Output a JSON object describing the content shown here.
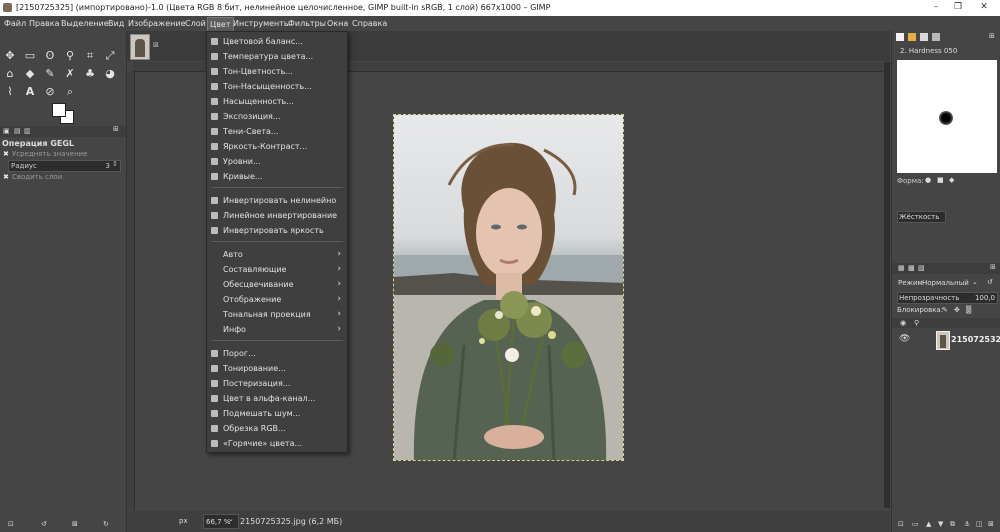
{
  "window": {
    "title": "[2150725325] (импортировано)-1.0 (Цвета RGB 8 бит, нелинейное целочисленное, GIMP built-in sRGB, 1 слой) 667x1000 – GIMP",
    "minimize": "–",
    "maximize": "❐",
    "close": "✕"
  },
  "menubar": {
    "items": [
      "Файл",
      "Правка",
      "Выделение",
      "Вид",
      "Изображение",
      "Слой",
      "Цвет",
      "Инструменты",
      "Фильтры",
      "Окна",
      "Справка"
    ]
  },
  "color_menu": {
    "group1": [
      "Цветовой баланс...",
      "Температура цвета...",
      "Тон-Цветность...",
      "Тон-Насыщенность...",
      "Насыщенность...",
      "Экспозиция...",
      "Тени-Света...",
      "Яркость-Контраст...",
      "Уровни...",
      "Кривые..."
    ],
    "group2": [
      "Инвертировать нелинейно",
      "Линейное инвертирование",
      "Инвертировать яркость"
    ],
    "group3": [
      "Авто",
      "Составляющие",
      "Обесцвечивание",
      "Отображение",
      "Тональная проекция",
      "Инфо"
    ],
    "group4": [
      "Порог...",
      "Тонирование...",
      "Постеризация...",
      "Цвет в альфа-канал...",
      "Подмешать шум...",
      "Обрезка RGB...",
      "«Горячие» цвета..."
    ]
  },
  "tool_options": {
    "title": "Операция GEGL",
    "sample_merged": "Усреднять значение",
    "radius_label": "Радиус",
    "radius_value": "3",
    "merge_layers": "Сводить слои"
  },
  "status": {
    "unit": "px",
    "zoom": "66,7 %",
    "file_info": "2150725325.jpg (6,2 МБ)"
  },
  "brushes": {
    "name": "2. Hardness 050",
    "shape_label": "Форма:",
    "hardness_label": "Жёсткость"
  },
  "layers": {
    "mode_label": "Режим",
    "mode_value": "Нормальный",
    "opacity_label": "Непрозрачность",
    "opacity_value": "100,0",
    "lock_label": "Блокировка:",
    "layer_name": "2150725325"
  }
}
